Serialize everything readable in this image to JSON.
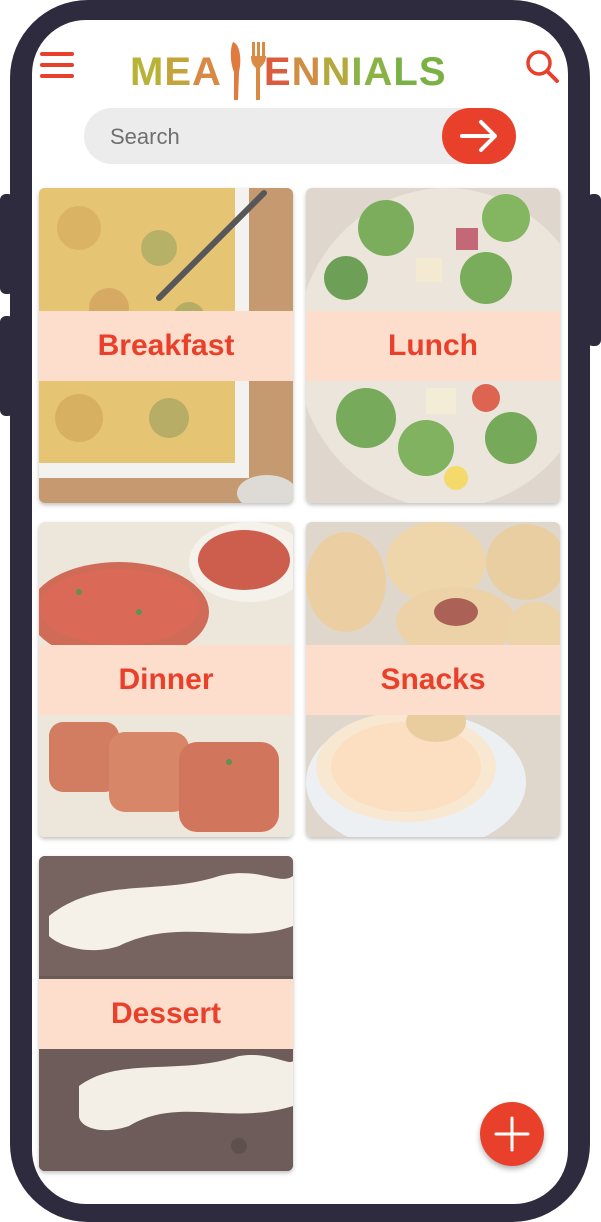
{
  "header": {
    "logo_text": "MEALLENNIALS",
    "menu_icon": "hamburger-menu-icon",
    "search_icon": "search-icon"
  },
  "search": {
    "placeholder": "Search",
    "submit_icon": "arrow-right-icon"
  },
  "categories": [
    {
      "label": "Breakfast",
      "image": "egg-casserole-photo"
    },
    {
      "label": "Lunch",
      "image": "broccoli-salad-photo"
    },
    {
      "label": "Dinner",
      "image": "meatloaf-photo"
    },
    {
      "label": "Snacks",
      "image": "pretzel-dogs-photo"
    },
    {
      "label": "Dessert",
      "image": "cheesecake-brownie-photo"
    }
  ],
  "fab": {
    "icon": "plus-icon"
  },
  "colors": {
    "accent": "#e8402a",
    "label_band": "#fdddcb",
    "frame": "#2d2b3d",
    "search_bg": "#ececec"
  }
}
